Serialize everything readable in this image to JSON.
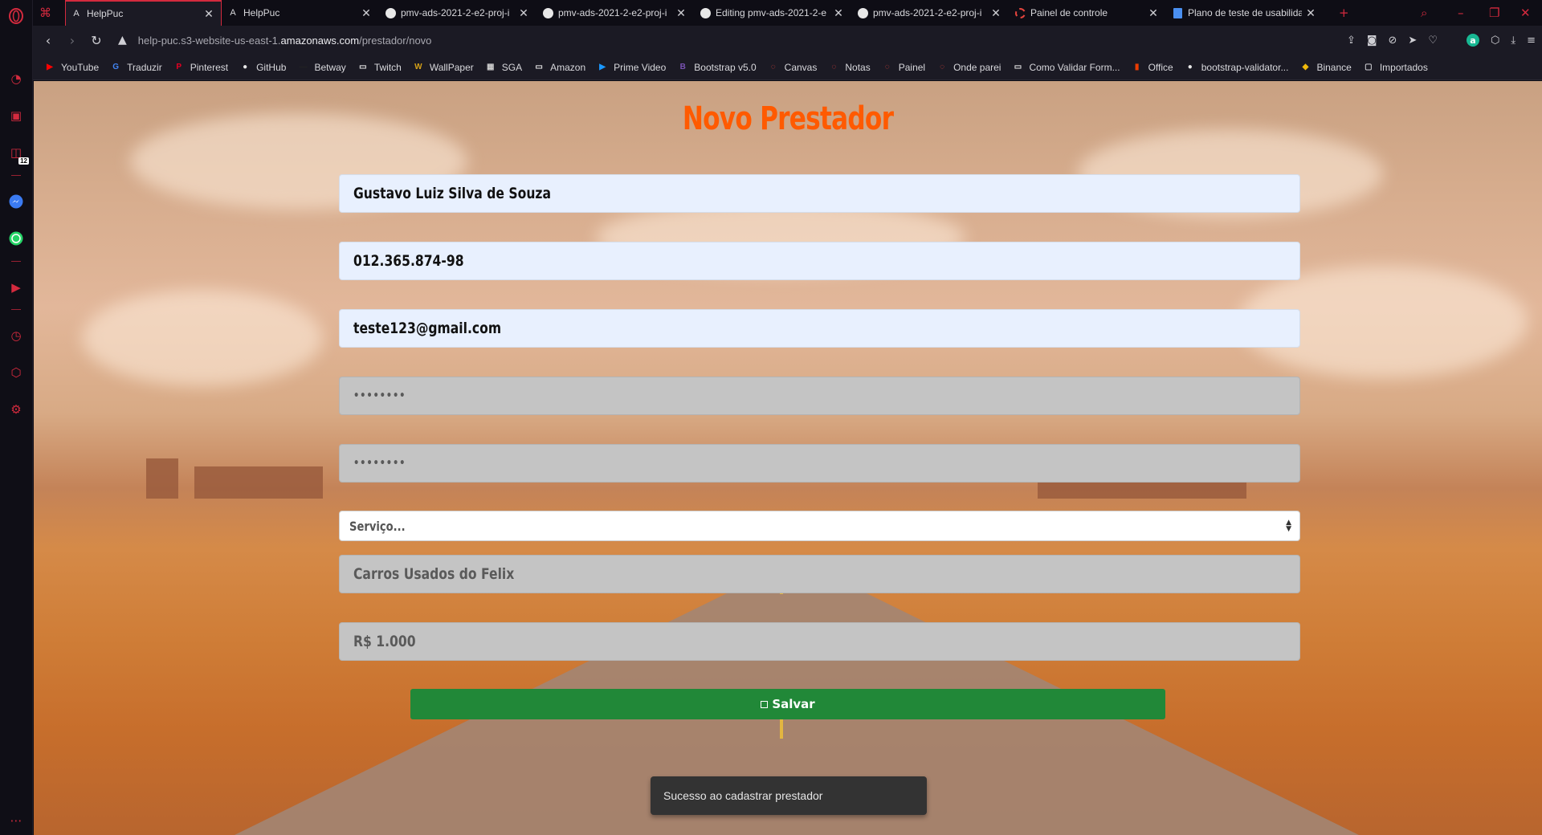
{
  "browser": {
    "tabs": [
      {
        "title": "HelpPuc",
        "favicon": "helppuc-a-icon",
        "active": true
      },
      {
        "title": "HelpPuc",
        "favicon": "helppuc-a-icon",
        "active": false
      },
      {
        "title": "pmv-ads-2021-2-e2-proj-i",
        "favicon": "github-icon",
        "active": false
      },
      {
        "title": "pmv-ads-2021-2-e2-proj-i",
        "favicon": "github-icon",
        "active": false
      },
      {
        "title": "Editing pmv-ads-2021-2-e",
        "favicon": "github-icon",
        "active": false
      },
      {
        "title": "pmv-ads-2021-2-e2-proj-i",
        "favicon": "github-icon",
        "active": false
      },
      {
        "title": "Painel de controle",
        "favicon": "canvas-icon",
        "active": false
      },
      {
        "title": "Plano de teste de usabilida",
        "favicon": "google-docs-icon",
        "active": false
      }
    ],
    "new_tab_symbol": "+",
    "url_prefix": "help-puc.s3-website-us-east-1.",
    "url_domain": "amazonaws.com",
    "url_path": "/prestador/novo",
    "account_initial": "a",
    "bookmarks": [
      {
        "label": "YouTube",
        "icon": "youtube-icon",
        "color": "#ff0000"
      },
      {
        "label": "Traduzir",
        "icon": "translate-icon",
        "color": "#4285f4"
      },
      {
        "label": "Pinterest",
        "icon": "pinterest-icon",
        "color": "#e60023"
      },
      {
        "label": "GitHub",
        "icon": "github-icon",
        "color": "#e8e8e8"
      },
      {
        "label": "Betway",
        "icon": "betway-icon",
        "color": "#222222"
      },
      {
        "label": "Twitch",
        "icon": "page-icon",
        "color": "#e8e8e8"
      },
      {
        "label": "WallPaper",
        "icon": "wallpaper-icon",
        "color": "#d4a017"
      },
      {
        "label": "SGA",
        "icon": "sga-icon",
        "color": "#cccccc"
      },
      {
        "label": "Amazon",
        "icon": "page-icon",
        "color": "#e8e8e8"
      },
      {
        "label": "Prime Video",
        "icon": "prime-video-icon",
        "color": "#1a98ff"
      },
      {
        "label": "Bootstrap v5.0",
        "icon": "bootstrap-icon",
        "color": "#7952b3"
      },
      {
        "label": "Canvas",
        "icon": "canvas-icon",
        "color": "#e4443d"
      },
      {
        "label": "Notas",
        "icon": "canvas-icon",
        "color": "#e4443d"
      },
      {
        "label": "Painel",
        "icon": "canvas-icon",
        "color": "#e4443d"
      },
      {
        "label": "Onde parei",
        "icon": "canvas-icon",
        "color": "#e4443d"
      },
      {
        "label": "Como Validar Form...",
        "icon": "page-icon",
        "color": "#e8e8e8"
      },
      {
        "label": "Office",
        "icon": "office-icon",
        "color": "#eb3c00"
      },
      {
        "label": "bootstrap-validator...",
        "icon": "github-icon",
        "color": "#e8e8e8"
      },
      {
        "label": "Binance",
        "icon": "binance-icon",
        "color": "#f0b90b"
      },
      {
        "label": "Importados",
        "icon": "folder-icon",
        "color": "#cfcfd4"
      }
    ],
    "sidebar_badge": "12"
  },
  "form": {
    "title": "Novo Prestador",
    "nome": "Gustavo Luiz Silva de Souza",
    "cpf": "012.365.874-98",
    "email": "teste123@gmail.com",
    "senha": "••••••••",
    "confirmar_senha": "••••••••",
    "servico_selected": "Serviço...",
    "empresa": "Carros Usados do Felix",
    "preco": "R$ 1.000",
    "save_label": "Salvar"
  },
  "toast": {
    "message": "Sucesso ao cadastrar prestador"
  }
}
